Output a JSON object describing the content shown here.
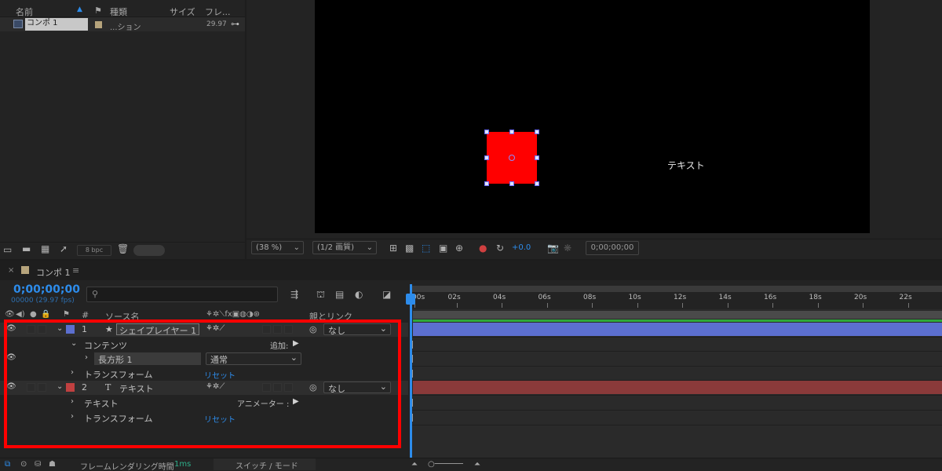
{
  "project": {
    "headers": {
      "name": "名前",
      "type": "種類",
      "size": "サイズ",
      "frame": "フレ..."
    },
    "item": {
      "name": "コンポ 1",
      "type": "...ション",
      "fps": "29.97"
    },
    "bpc": "8 bpc"
  },
  "viewer": {
    "zoom": "(38 %)",
    "resolution": "(1/2 画質)",
    "exposure": "+0.0",
    "timecode": "0;00;00;00",
    "canvas_text": "テキスト",
    "shape_color": "#ff0000"
  },
  "timeline": {
    "tab": "コンポ 1",
    "timecode": "0;00;00;00",
    "fps": "00000 (29.97 fps)",
    "columns": {
      "num": "#",
      "source": "ソース名",
      "parent": "親とリンク"
    },
    "ticks": [
      ":00s",
      "02s",
      "04s",
      "06s",
      "08s",
      "10s",
      "12s",
      "14s",
      "16s",
      "18s",
      "20s",
      "22s"
    ],
    "layers": [
      {
        "num": "1",
        "name": "シェイプレイヤー 1",
        "parent": "なし",
        "color": "#5c6fcf"
      },
      {
        "num": "2",
        "name": "テキスト",
        "parent": "なし",
        "color": "#c04040"
      }
    ],
    "contents": "コンテンツ",
    "add": "追加:",
    "rect": "長方形 1",
    "blend": "通常",
    "transform": "トランスフォーム",
    "reset": "リセット",
    "text_prop": "テキスト",
    "animator": "アニメーター :",
    "footer": {
      "render": "フレームレンダリング時間",
      "render_val": "1ms",
      "switch": "スイッチ / モード"
    }
  }
}
